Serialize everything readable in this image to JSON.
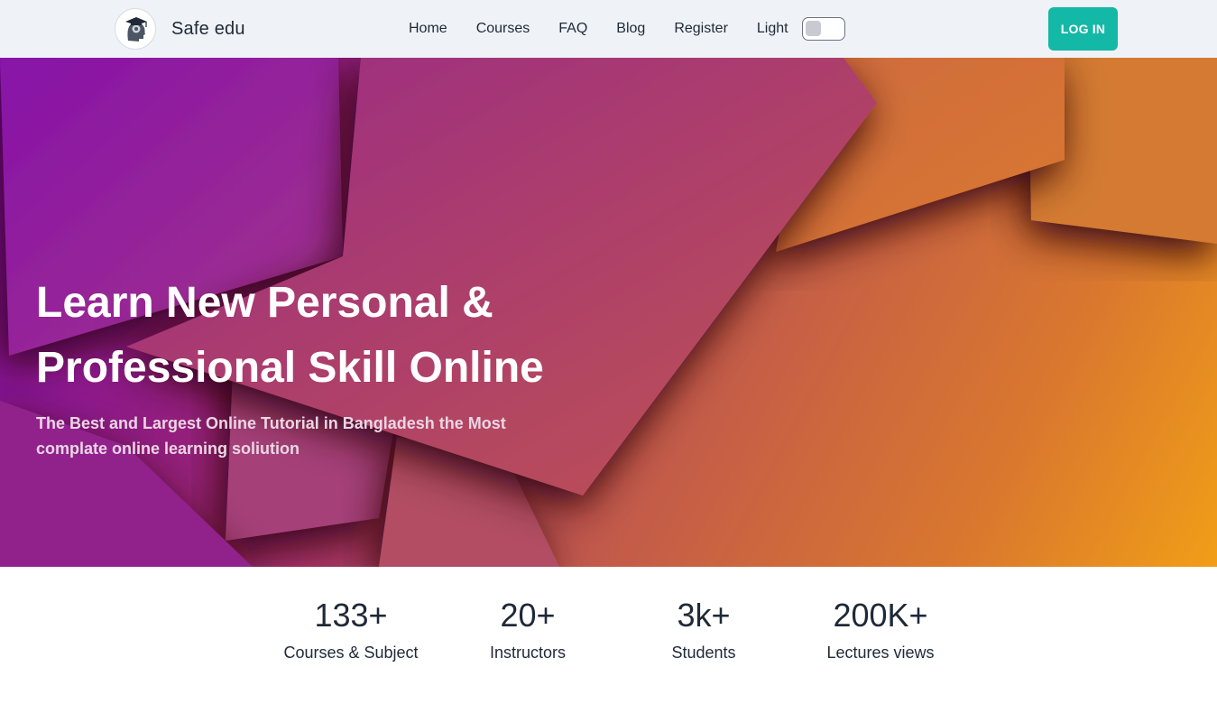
{
  "brand": {
    "name": "Safe edu",
    "logo_icon": "graduate-head-icon"
  },
  "nav": {
    "items": [
      "Home",
      "Courses",
      "FAQ",
      "Blog",
      "Register"
    ],
    "theme_label": "Light"
  },
  "login_label": "LOG IN",
  "hero": {
    "title": "Learn New Personal & Professional Skill Online",
    "subtitle": "The Best and Largest Online Tutorial in Bangladesh the Most complate online learning soliution"
  },
  "stats": [
    {
      "value": "133+",
      "label": "Courses & Subject"
    },
    {
      "value": "20+",
      "label": "Instructors"
    },
    {
      "value": "3k+",
      "label": "Students"
    },
    {
      "value": "200K+",
      "label": "Lectures views"
    }
  ],
  "colors": {
    "accent": "#14b8a6",
    "navbar_bg": "#eff3f8",
    "text": "#1f2937"
  }
}
